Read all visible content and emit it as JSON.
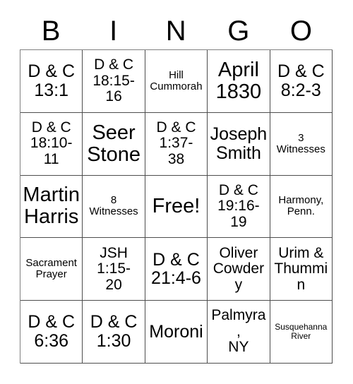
{
  "card": {
    "header_letters": [
      "B",
      "I",
      "N",
      "G",
      "O"
    ],
    "columns": 5,
    "rows": 5,
    "cells": [
      {
        "text": "D & C\n13:1",
        "size": "lg"
      },
      {
        "text": "D & C\n18:15-\n16",
        "size": "md"
      },
      {
        "text": "Hill\nCummorah",
        "size": "sm"
      },
      {
        "text": "April\n1830",
        "size": "xl"
      },
      {
        "text": "D & C\n8:2-3",
        "size": "lg"
      },
      {
        "text": "D & C\n18:10-\n11",
        "size": "md"
      },
      {
        "text": "Seer\nStone",
        "size": "xl"
      },
      {
        "text": "D & C\n1:37-\n38",
        "size": "md"
      },
      {
        "text": "Joseph\nSmith",
        "size": "lg"
      },
      {
        "text": "3\nWitnesses",
        "size": "sm"
      },
      {
        "text": "Martin\nHarris",
        "size": "xl"
      },
      {
        "text": "8\nWitnesses",
        "size": "sm"
      },
      {
        "text": "Free!",
        "size": "xl"
      },
      {
        "text": "D & C\n19:16-\n19",
        "size": "md"
      },
      {
        "text": "Harmony,\nPenn.",
        "size": "sm"
      },
      {
        "text": "Sacrament\nPrayer",
        "size": "sm"
      },
      {
        "text": "JSH\n1:15-\n20",
        "size": "md"
      },
      {
        "text": "D & C\n21:4-6",
        "size": "lg"
      },
      {
        "text": "Oliver\nCowdery",
        "size": "md"
      },
      {
        "text": "Urim &\nThummin",
        "size": "md"
      },
      {
        "text": "D & C\n6:36",
        "size": "lg"
      },
      {
        "text": "D & C\n1:30",
        "size": "lg"
      },
      {
        "text": "Moroni",
        "size": "lg"
      },
      {
        "text": "Palmyra,\nNY",
        "size": "md"
      },
      {
        "text": "Susquehanna\nRiver",
        "size": "xs"
      }
    ]
  },
  "colors": {
    "background": "#ffffff",
    "text": "#000000",
    "grid_line": "#4d4d4d"
  }
}
